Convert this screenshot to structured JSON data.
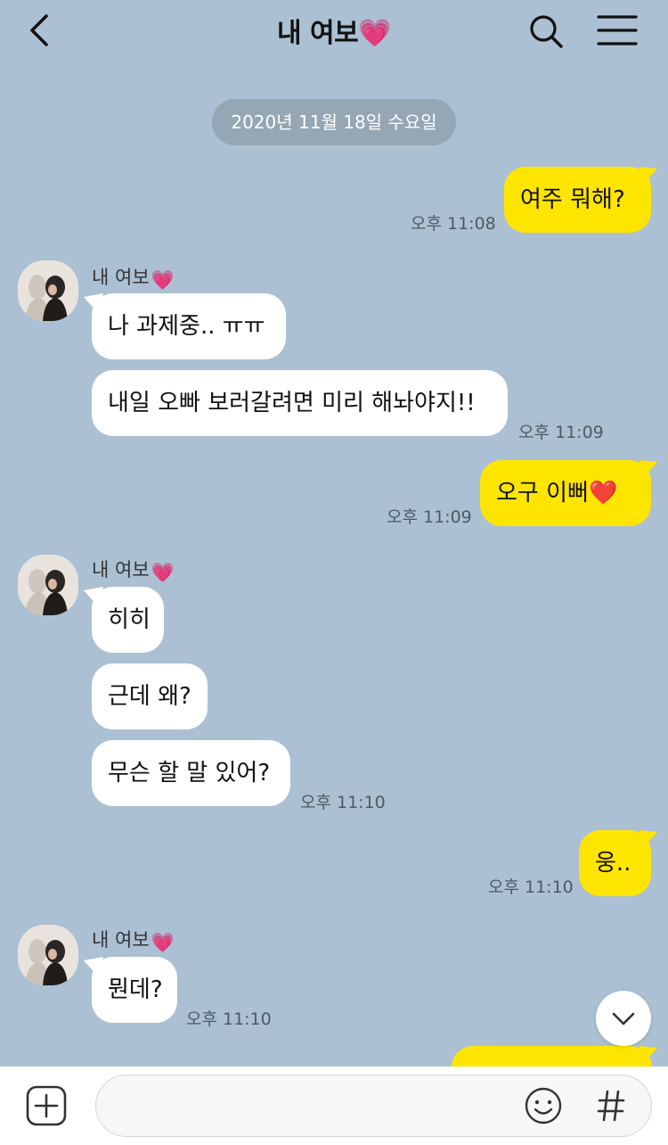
{
  "header": {
    "title": "내 여보",
    "heart_emoji": "💗"
  },
  "date_divider": "2020년 11월 18일 수요일",
  "messages": [
    {
      "from": "me",
      "text": "여주 뭐해?",
      "time": "오후 11:08"
    },
    {
      "from": "other",
      "sender": "내 여보",
      "text": "나 과제중.. ㅠㅠ"
    },
    {
      "from": "other",
      "text": "내일 오빠 보러갈려면 미리 해놔야지!!",
      "time": "오후 11:09"
    },
    {
      "from": "me",
      "text": "오구 이뻐",
      "emoji": "❤️",
      "time": "오후 11:09"
    },
    {
      "from": "other",
      "sender": "내 여보",
      "text": "히히"
    },
    {
      "from": "other",
      "text": "근데 왜?"
    },
    {
      "from": "other",
      "text": "무슨 할 말 있어?",
      "time": "오후 11:10"
    },
    {
      "from": "me",
      "text": "웅..",
      "time": "오후 11:10"
    },
    {
      "from": "other",
      "sender": "내 여보",
      "text": "뭔데?",
      "time": "오후 11:10"
    }
  ],
  "input": {
    "placeholder": ""
  },
  "icons": {
    "back": "chevron-left-icon",
    "search": "search-icon",
    "menu": "hamburger-menu-icon",
    "scroll": "chevron-down-icon",
    "plus": "plus-square-icon",
    "emoji": "smiley-icon",
    "hash": "hash-icon"
  },
  "colors": {
    "background": "#abc0d3",
    "my_bubble": "#fee500",
    "their_bubble": "#ffffff",
    "date_pill": "#95a6b5"
  }
}
